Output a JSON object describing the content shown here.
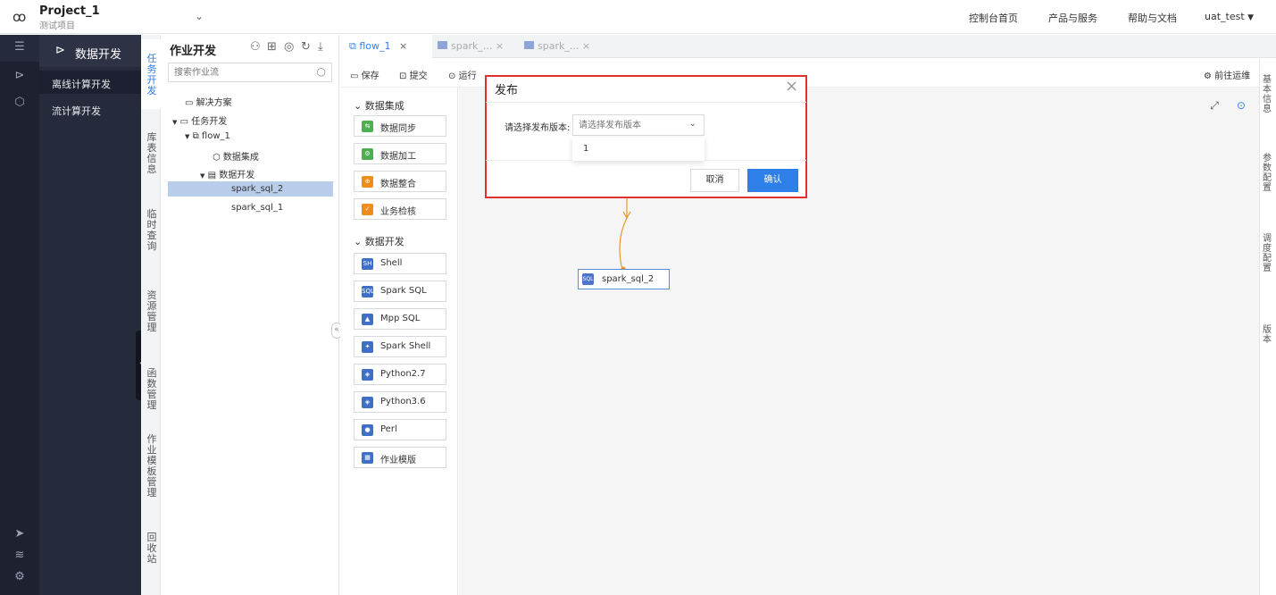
{
  "header": {
    "project_name": "Project_1",
    "project_sub": "测试项目",
    "nav": [
      "控制台首页",
      "产品与服务",
      "帮助与文档"
    ],
    "user": "uat_test"
  },
  "sidemenu": {
    "title": "数据开发",
    "items": [
      "离线计算开发",
      "流计算开发"
    ]
  },
  "vtabs": {
    "active": "任务开发",
    "items": [
      "库表信息",
      "临时查询",
      "资源管理",
      "函数管理",
      "作业模板管理",
      "回收站"
    ]
  },
  "tree": {
    "title": "作业开发",
    "search_placeholder": "搜索作业流",
    "rows": [
      "解决方案",
      "任务开发",
      "flow_1",
      "数据集成",
      "数据开发",
      "spark_sql_2",
      "spark_sql_1"
    ]
  },
  "tabs": [
    "flow_1",
    "spark_...",
    "spark_..."
  ],
  "toolbar": {
    "save": "保存",
    "submit": "提交",
    "run": "运行",
    "goto_ops": "前往运维"
  },
  "palette": {
    "group1": "数据集成",
    "group1_items": [
      "数据同步",
      "数据加工",
      "数据整合",
      "业务检核"
    ],
    "group2": "数据开发",
    "group2_items": [
      "Shell",
      "Spark SQL",
      "Mpp SQL",
      "Spark Shell",
      "Python2.7",
      "Python3.6",
      "Perl",
      "作业模版"
    ]
  },
  "canvas": {
    "node_label": "spark_sql_2"
  },
  "rightstrip": [
    "基本信息",
    "参数配置",
    "调度配置",
    "版本"
  ],
  "dialog": {
    "title": "发布",
    "label": "请选择发布版本:",
    "placeholder": "请选择发布版本",
    "option": "1",
    "cancel": "取消",
    "ok": "确认"
  },
  "colors": {
    "accent": "#2f7fe8",
    "dialog_border": "#e0322c",
    "flow_line": "#e8962c"
  }
}
